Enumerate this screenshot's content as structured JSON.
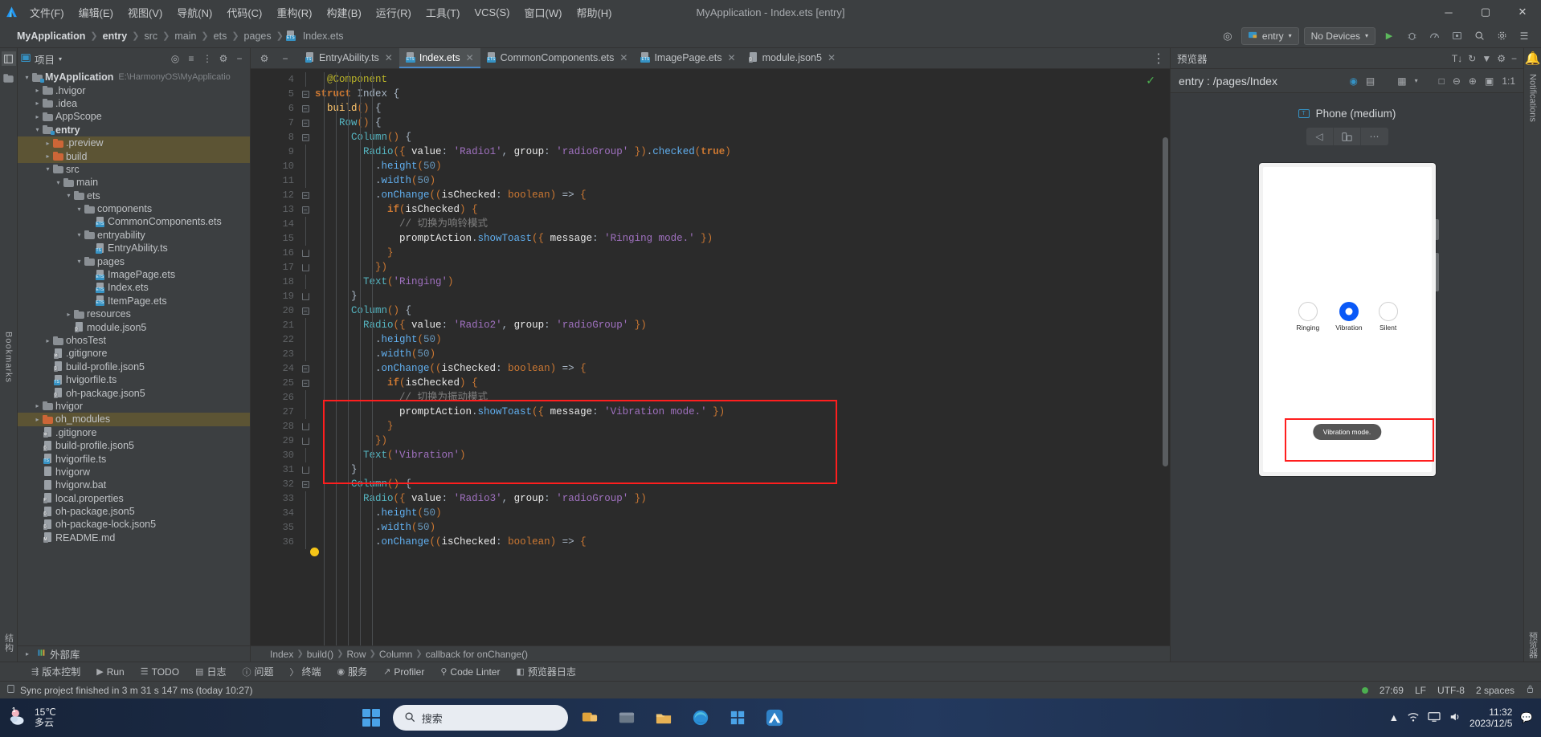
{
  "window": {
    "title": "MyApplication - Index.ets [entry]",
    "menu": [
      "文件(F)",
      "编辑(E)",
      "视图(V)",
      "导航(N)",
      "代码(C)",
      "重构(R)",
      "构建(B)",
      "运行(R)",
      "工具(T)",
      "VCS(S)",
      "窗口(W)",
      "帮助(H)"
    ],
    "controls": {
      "minimize": "─",
      "maximize": "▢",
      "close": "✕"
    }
  },
  "navbar": {
    "breadcrumb": [
      {
        "label": "MyApplication",
        "bold": true
      },
      {
        "label": "entry",
        "bold": true
      },
      {
        "label": "src",
        "bold": false
      },
      {
        "label": "main",
        "bold": false
      },
      {
        "label": "ets",
        "bold": false
      },
      {
        "label": "pages",
        "bold": false
      },
      {
        "label": "Index.ets",
        "bold": false,
        "icon": "ets-file-icon"
      }
    ],
    "run_config": "entry",
    "device_selector": "No Devices",
    "icons": [
      "target-icon",
      "run-icon",
      "debug-icon",
      "profile-icon",
      "attach-icon",
      "search-icon",
      "settings-icon",
      "more-icon"
    ]
  },
  "project_panel": {
    "title": "项目",
    "actions": [
      "locate-icon",
      "expand-all-icon",
      "collapse-all-icon",
      "hide-icon"
    ],
    "tree": [
      {
        "depth": 0,
        "arrow": "v",
        "icon": "module-folder",
        "label": "MyApplication",
        "bold": true,
        "sub": "E:\\HarmonyOS\\MyApplicatio"
      },
      {
        "depth": 1,
        "arrow": ">",
        "icon": "folder",
        "label": ".hvigor"
      },
      {
        "depth": 1,
        "arrow": ">",
        "icon": "folder",
        "label": ".idea"
      },
      {
        "depth": 1,
        "arrow": ">",
        "icon": "folder",
        "label": "AppScope"
      },
      {
        "depth": 1,
        "arrow": "v",
        "icon": "module-folder",
        "label": "entry",
        "bold": true
      },
      {
        "depth": 2,
        "arrow": ">",
        "icon": "folder-orange",
        "label": ".preview",
        "highlight": true
      },
      {
        "depth": 2,
        "arrow": ">",
        "icon": "folder-orange",
        "label": "build",
        "highlight": true
      },
      {
        "depth": 2,
        "arrow": "v",
        "icon": "folder",
        "label": "src"
      },
      {
        "depth": 3,
        "arrow": "v",
        "icon": "folder",
        "label": "main"
      },
      {
        "depth": 4,
        "arrow": "v",
        "icon": "folder",
        "label": "ets"
      },
      {
        "depth": 5,
        "arrow": "v",
        "icon": "folder",
        "label": "components"
      },
      {
        "depth": 6,
        "arrow": "",
        "icon": "ets-file",
        "label": "CommonComponents.ets"
      },
      {
        "depth": 5,
        "arrow": "v",
        "icon": "folder",
        "label": "entryability"
      },
      {
        "depth": 6,
        "arrow": "",
        "icon": "ts-file",
        "label": "EntryAbility.ts"
      },
      {
        "depth": 5,
        "arrow": "v",
        "icon": "folder",
        "label": "pages"
      },
      {
        "depth": 6,
        "arrow": "",
        "icon": "ets-file",
        "label": "ImagePage.ets"
      },
      {
        "depth": 6,
        "arrow": "",
        "icon": "ets-file",
        "label": "Index.ets"
      },
      {
        "depth": 6,
        "arrow": "",
        "icon": "ets-file",
        "label": "ItemPage.ets"
      },
      {
        "depth": 4,
        "arrow": ">",
        "icon": "folder",
        "label": "resources"
      },
      {
        "depth": 4,
        "arrow": "",
        "icon": "json-file",
        "label": "module.json5"
      },
      {
        "depth": 2,
        "arrow": ">",
        "icon": "folder",
        "label": "ohosTest"
      },
      {
        "depth": 2,
        "arrow": "",
        "icon": "git-file",
        "label": ".gitignore"
      },
      {
        "depth": 2,
        "arrow": "",
        "icon": "json-file",
        "label": "build-profile.json5"
      },
      {
        "depth": 2,
        "arrow": "",
        "icon": "ts-file",
        "label": "hvigorfile.ts"
      },
      {
        "depth": 2,
        "arrow": "",
        "icon": "json-file",
        "label": "oh-package.json5"
      },
      {
        "depth": 1,
        "arrow": ">",
        "icon": "folder",
        "label": "hvigor"
      },
      {
        "depth": 1,
        "arrow": ">",
        "icon": "folder-orange",
        "label": "oh_modules",
        "highlight": true
      },
      {
        "depth": 1,
        "arrow": "",
        "icon": "git-file",
        "label": ".gitignore"
      },
      {
        "depth": 1,
        "arrow": "",
        "icon": "json-file",
        "label": "build-profile.json5"
      },
      {
        "depth": 1,
        "arrow": "",
        "icon": "ts-file",
        "label": "hvigorfile.ts"
      },
      {
        "depth": 1,
        "arrow": "",
        "icon": "file",
        "label": "hvigorw"
      },
      {
        "depth": 1,
        "arrow": "",
        "icon": "file",
        "label": "hvigorw.bat"
      },
      {
        "depth": 1,
        "arrow": "",
        "icon": "props-file",
        "label": "local.properties"
      },
      {
        "depth": 1,
        "arrow": "",
        "icon": "json-file",
        "label": "oh-package.json5"
      },
      {
        "depth": 1,
        "arrow": "",
        "icon": "json-file",
        "label": "oh-package-lock.json5"
      },
      {
        "depth": 1,
        "arrow": "",
        "icon": "md-file",
        "label": "README.md"
      }
    ],
    "external_libraries": "外部库"
  },
  "left_rail": {
    "items": [
      "项目",
      "结构",
      "书签"
    ],
    "bottom_labels": [
      "Bookmarks",
      "结构"
    ]
  },
  "right_rail": {
    "labels": [
      "Notifications",
      "预览器"
    ]
  },
  "editor": {
    "tabs": [
      {
        "label": "EntryAbility.ts",
        "icon": "ts-file",
        "active": false
      },
      {
        "label": "Index.ets",
        "icon": "ets-file",
        "active": true
      },
      {
        "label": "CommonComponents.ets",
        "icon": "ets-file",
        "active": false
      },
      {
        "label": "ImagePage.ets",
        "icon": "ets-file",
        "active": false
      },
      {
        "label": "module.json5",
        "icon": "json-file",
        "active": false
      }
    ],
    "first_line_number": 4,
    "lines": [
      {
        "n": 4,
        "indent": 1,
        "html": "<span class=\"deco\">@Component</span>"
      },
      {
        "n": 5,
        "indent": 0,
        "html": "<span class=\"kw\">struct</span> <span class=\"cls\">Index</span> <span class=\"punct\">{</span>",
        "fold": "minus"
      },
      {
        "n": 6,
        "indent": 1,
        "html": "<span class=\"fn\">build</span><span class=\"par\">()</span> <span class=\"punct\">{</span>",
        "fold": "minus"
      },
      {
        "n": 7,
        "indent": 2,
        "html": "<span class=\"bluefn\">Row</span><span class=\"par\">()</span> <span class=\"punct\">{</span>",
        "fold": "minus"
      },
      {
        "n": 8,
        "indent": 3,
        "html": "<span class=\"bluefn\">Column</span><span class=\"par\">()</span> <span class=\"punct\">{</span>",
        "fold": "minus"
      },
      {
        "n": 9,
        "indent": 4,
        "html": "<span class=\"bluefn\">Radio</span><span class=\"par\">({</span> <span class=\"prop\">value</span><span class=\"punct\">:</span> <span class=\"str\">'Radio1'</span><span class=\"punct\">,</span> <span class=\"prop\">group</span><span class=\"punct\">:</span> <span class=\"str\">'radioGroup'</span> <span class=\"par\">})</span><span class=\"punct\">.</span><span class=\"meth\">checked</span><span class=\"par\">(</span><span class=\"kw\">true</span><span class=\"par\">)</span>"
      },
      {
        "n": 10,
        "indent": 5,
        "html": "<span class=\"punct\">.</span><span class=\"meth\">height</span><span class=\"par\">(</span><span class=\"num\">50</span><span class=\"par\">)</span>"
      },
      {
        "n": 11,
        "indent": 5,
        "html": "<span class=\"punct\">.</span><span class=\"meth\">width</span><span class=\"par\">(</span><span class=\"num\">50</span><span class=\"par\">)</span>"
      },
      {
        "n": 12,
        "indent": 5,
        "html": "<span class=\"punct\">.</span><span class=\"meth\">onChange</span><span class=\"par\">((</span><span class=\"prop\">isChecked</span><span class=\"punct\">:</span> <span class=\"type\">boolean</span><span class=\"par\">)</span> <span class=\"punct\">=&gt;</span> <span class=\"par\">{</span>",
        "fold": "minus"
      },
      {
        "n": 13,
        "indent": 6,
        "html": "<span class=\"kw\">if</span><span class=\"par\">(</span><span class=\"prop\">isChecked</span><span class=\"par\">)</span> <span class=\"par\">{</span>",
        "fold": "minus"
      },
      {
        "n": 14,
        "indent": 7,
        "html": "<span class=\"com\">// 切换为响铃模式</span>"
      },
      {
        "n": 15,
        "indent": 7,
        "html": "<span class=\"prop\">promptAction</span><span class=\"punct\">.</span><span class=\"meth\">showToast</span><span class=\"par\">({</span> <span class=\"prop\">message</span><span class=\"punct\">:</span> <span class=\"str\">'Ringing mode.'</span> <span class=\"par\">})</span>"
      },
      {
        "n": 16,
        "indent": 6,
        "html": "<span class=\"par\">}</span>",
        "fold": "up"
      },
      {
        "n": 17,
        "indent": 5,
        "html": "<span class=\"par\">})</span>",
        "fold": "up"
      },
      {
        "n": 18,
        "indent": 4,
        "html": "<span class=\"bluefn\">Text</span><span class=\"par\">(</span><span class=\"str\">'Ringing'</span><span class=\"par\">)</span>"
      },
      {
        "n": 19,
        "indent": 3,
        "html": "<span class=\"punct\">}</span>",
        "fold": "up"
      },
      {
        "n": 20,
        "indent": 3,
        "html": "<span class=\"bluefn\">Column</span><span class=\"par\">()</span> <span class=\"punct\">{</span>",
        "fold": "minus"
      },
      {
        "n": 21,
        "indent": 4,
        "html": "<span class=\"bluefn\">Radio</span><span class=\"par\">({</span> <span class=\"prop\">value</span><span class=\"punct\">:</span> <span class=\"str\">'Radio2'</span><span class=\"punct\">,</span> <span class=\"prop\">group</span><span class=\"punct\">:</span> <span class=\"str\">'radioGroup'</span> <span class=\"par\">})</span>"
      },
      {
        "n": 22,
        "indent": 5,
        "html": "<span class=\"punct\">.</span><span class=\"meth\">height</span><span class=\"par\">(</span><span class=\"num\">50</span><span class=\"par\">)</span>"
      },
      {
        "n": 23,
        "indent": 5,
        "html": "<span class=\"punct\">.</span><span class=\"meth\">width</span><span class=\"par\">(</span><span class=\"num\">50</span><span class=\"par\">)</span>"
      },
      {
        "n": 24,
        "indent": 5,
        "html": "<span class=\"punct\">.</span><span class=\"meth\">onChange</span><span class=\"par\">((</span><span class=\"prop\">isChecked</span><span class=\"punct\">:</span> <span class=\"type\">boolean</span><span class=\"par\">)</span> <span class=\"punct\">=&gt;</span> <span class=\"par\">{</span>",
        "fold": "minus"
      },
      {
        "n": 25,
        "indent": 6,
        "html": "<span class=\"kw\">if</span><span class=\"par\">(</span><span class=\"prop\">isChecked</span><span class=\"par\">)</span> <span class=\"par\">{</span>",
        "fold": "minus"
      },
      {
        "n": 26,
        "indent": 7,
        "html": "<span class=\"com\">// 切换为振动模式</span>"
      },
      {
        "n": 27,
        "indent": 7,
        "html": "<span class=\"prop\">promptAction</span><span class=\"punct\">.</span><span class=\"meth\">showToast</span><span class=\"par\">({</span> <span class=\"prop\">message</span><span class=\"punct\">:</span> <span class=\"str\">'Vibration mode.'</span> <span class=\"par\">})</span>",
        "bulb": true
      },
      {
        "n": 28,
        "indent": 6,
        "html": "<span class=\"par\">}</span>",
        "fold": "up"
      },
      {
        "n": 29,
        "indent": 5,
        "html": "<span class=\"par\">})</span>",
        "fold": "up"
      },
      {
        "n": 30,
        "indent": 4,
        "html": "<span class=\"bluefn\">Text</span><span class=\"par\">(</span><span class=\"str\">'Vibration'</span><span class=\"par\">)</span>"
      },
      {
        "n": 31,
        "indent": 3,
        "html": "<span class=\"punct\">}</span>",
        "fold": "up"
      },
      {
        "n": 32,
        "indent": 3,
        "html": "<span class=\"bluefn\">Column</span><span class=\"par\">()</span> <span class=\"punct\">{</span>",
        "fold": "minus"
      },
      {
        "n": 33,
        "indent": 4,
        "html": "<span class=\"bluefn\">Radio</span><span class=\"par\">({</span> <span class=\"prop\">value</span><span class=\"punct\">:</span> <span class=\"str\">'Radio3'</span><span class=\"punct\">,</span> <span class=\"prop\">group</span><span class=\"punct\">:</span> <span class=\"str\">'radioGroup'</span> <span class=\"par\">})</span>"
      },
      {
        "n": 34,
        "indent": 5,
        "html": "<span class=\"punct\">.</span><span class=\"meth\">height</span><span class=\"par\">(</span><span class=\"num\">50</span><span class=\"par\">)</span>"
      },
      {
        "n": 35,
        "indent": 5,
        "html": "<span class=\"punct\">.</span><span class=\"meth\">width</span><span class=\"par\">(</span><span class=\"num\">50</span><span class=\"par\">)</span>"
      },
      {
        "n": 36,
        "indent": 5,
        "html": "<span class=\"punct\">.</span><span class=\"meth\">onChange</span><span class=\"par\">((</span><span class=\"prop\">isChecked</span><span class=\"punct\">:</span> <span class=\"type\">boolean</span><span class=\"par\">)</span> <span class=\"punct\">=&gt;</span> <span class=\"par\">{</span>"
      }
    ],
    "breadcrumb": [
      "Index",
      "build()",
      "Row",
      "Column",
      "callback for onChange()"
    ]
  },
  "previewer": {
    "title": "预览器",
    "path": "entry : /pages/Index",
    "device_name": "Phone (medium)",
    "zoom_label": "1:1",
    "device_controls": [
      "rotate-icon",
      "multi-device-icon",
      "more-icon"
    ],
    "toolbar_icons": [
      "inspector-icon",
      "layers-icon",
      "grid-icon",
      "dropdown-icon",
      "frame-icon",
      "zoom-out-icon",
      "zoom-in-icon",
      "fit-icon"
    ],
    "phone": {
      "radios": [
        {
          "label": "Ringing",
          "selected": false
        },
        {
          "label": "Vibration",
          "selected": true
        },
        {
          "label": "Silent",
          "selected": false
        }
      ],
      "toast": "Vibration mode.",
      "accent_color": "#0a59f7"
    }
  },
  "bottom_toolwindows": [
    {
      "label": "版本控制",
      "icon": "branch-icon"
    },
    {
      "label": "Run",
      "icon": "run-icon"
    },
    {
      "label": "TODO",
      "icon": "todo-icon"
    },
    {
      "label": "日志",
      "icon": "log-icon"
    },
    {
      "label": "问题",
      "icon": "problems-icon"
    },
    {
      "label": "终端",
      "icon": "terminal-icon"
    },
    {
      "label": "服务",
      "icon": "services-icon"
    },
    {
      "label": "Profiler",
      "icon": "profiler-icon"
    },
    {
      "label": "Code Linter",
      "icon": "linter-icon"
    },
    {
      "label": "预览器日志",
      "icon": "preview-log-icon"
    }
  ],
  "statusbar": {
    "message": "Sync project finished in 3 m 31 s 147 ms (today 10:27)",
    "caret": "27:69",
    "line_sep": "LF",
    "encoding": "UTF-8",
    "indent": "2 spaces",
    "lock_icon": "lock-icon"
  },
  "taskbar": {
    "weather_temp": "15℃",
    "weather_desc": "多云",
    "weather_badge": "1",
    "search_placeholder": "搜索",
    "time": "11:32",
    "date": "2023/12/5",
    "apps": [
      "widgets-icon",
      "search-icon",
      "folder-icon",
      "explorer-icon",
      "edge-icon",
      "store-icon",
      "devstudio-icon"
    ],
    "tray": [
      "chevron-up-icon",
      "network-icon",
      "monitor-icon",
      "volume-icon"
    ]
  },
  "colors": {
    "accent": "#3592c4",
    "highlight_red": "#ff1e1e",
    "panel_bg": "#3c3f41",
    "editor_bg": "#2b2b2b",
    "selection_gold": "#5c5434"
  }
}
